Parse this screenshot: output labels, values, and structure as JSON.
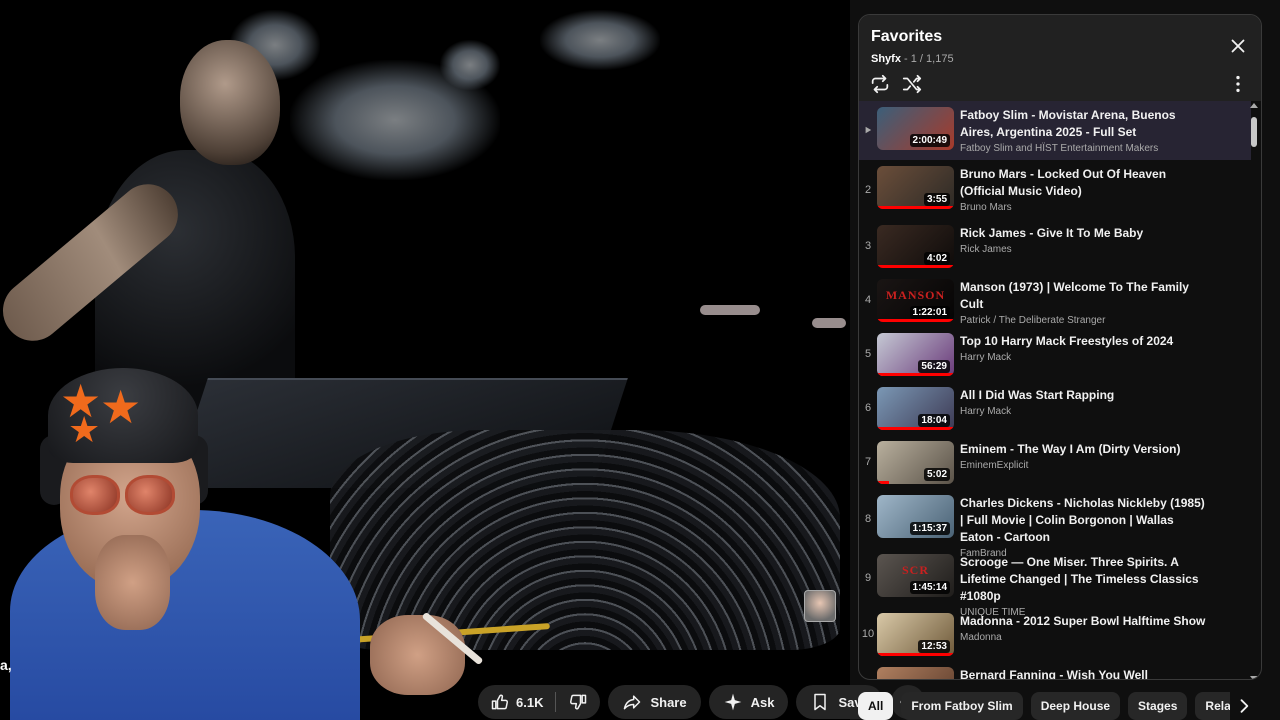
{
  "video": {
    "corner_left_text": "a,"
  },
  "actions": {
    "like_count": "6.1K",
    "share_label": "Share",
    "ask_label": "Ask",
    "save_label": "Save"
  },
  "playlist": {
    "title": "Favorites",
    "owner": "Shyfx",
    "position": " - 1 / 1,175",
    "items": [
      {
        "index": "",
        "title": "Fatboy Slim - Movistar Arena, Buenos Aires, Argentina 2025 - Full Set",
        "channel": "Fatboy Slim and HÏST Entertainment Makers",
        "duration": "2:00:49",
        "progress": 0,
        "thumb_colors": [
          "#3b5f7a",
          "#a83a2a"
        ]
      },
      {
        "index": "2",
        "title": "Bruno Mars - Locked Out Of Heaven (Official Music Video)",
        "channel": "Bruno Mars",
        "duration": "3:55",
        "progress": 1.0,
        "thumb_colors": [
          "#6b4e3a",
          "#2d2a26"
        ]
      },
      {
        "index": "3",
        "title": "Rick James - Give It To Me Baby",
        "channel": "Rick James",
        "duration": "4:02",
        "progress": 1.0,
        "thumb_colors": [
          "#3a2a22",
          "#0e0b0a"
        ]
      },
      {
        "index": "4",
        "title": "Manson (1973) | Welcome To The Family Cult",
        "channel": "Patrick / The Deliberate Stranger",
        "duration": "1:22:01",
        "progress": 1.0,
        "thumb_colors": [
          "#1a1514",
          "#050404"
        ],
        "thumb_text": "MANSON"
      },
      {
        "index": "5",
        "title": "Top 10 Harry Mack Freestyles of 2024",
        "channel": "Harry Mack",
        "duration": "56:29",
        "progress": 1.0,
        "thumb_colors": [
          "#c5c9d4",
          "#6a3a7a"
        ]
      },
      {
        "index": "6",
        "title": "All I Did Was Start Rapping",
        "channel": "Harry Mack",
        "duration": "18:04",
        "progress": 1.0,
        "thumb_colors": [
          "#7b98b5",
          "#3d3a54"
        ]
      },
      {
        "index": "7",
        "title": "Eminem - The Way I Am (Dirty Version)",
        "channel": "EminemExplicit",
        "duration": "5:02",
        "progress": 0.15,
        "thumb_colors": [
          "#b9b09e",
          "#5a5248"
        ]
      },
      {
        "index": "8",
        "title": "Charles Dickens - Nicholas Nickleby (1985) | Full Movie | Colin Borgonon | Wallas Eaton - Cartoon",
        "channel": "FamBrand",
        "duration": "1:15:37",
        "progress": 0,
        "thumb_colors": [
          "#9fb6c8",
          "#4a6275"
        ]
      },
      {
        "index": "9",
        "title": "Scrooge — One Miser. Three Spirits. A Lifetime Changed | The Timeless Classics #1080p",
        "channel": "UNIQUE TIME",
        "duration": "1:45:14",
        "progress": 0,
        "thumb_colors": [
          "#5b5550",
          "#1f1d1b"
        ],
        "thumb_text": "SCR"
      },
      {
        "index": "10",
        "title": "Madonna - 2012 Super Bowl Halftime Show",
        "channel": "Madonna",
        "duration": "12:53",
        "progress": 1.0,
        "thumb_colors": [
          "#d9c9a8",
          "#6f5a3a"
        ]
      },
      {
        "index": "",
        "title": "Bernard Fanning - Wish You Well",
        "channel": "",
        "duration": "",
        "progress": 0,
        "thumb_colors": [
          "#b08060",
          "#5a3a2a"
        ]
      }
    ]
  },
  "chips": [
    "All",
    "From Fatboy Slim",
    "Deep House",
    "Stages",
    "Related"
  ],
  "colors": {
    "active_row": "#272433",
    "progress_red": "#ff0000",
    "panel_header": "#212121"
  }
}
